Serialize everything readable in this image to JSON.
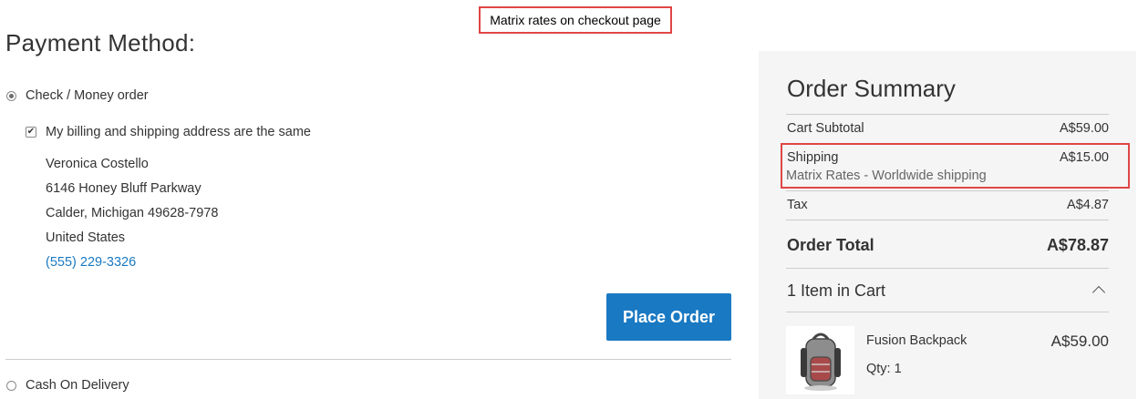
{
  "annotation": {
    "caption": "Matrix rates on checkout page"
  },
  "payment": {
    "title": "Payment Method:",
    "option_check": "Check / Money order",
    "billing_same_label": "My billing and shipping address are the same",
    "address": {
      "name": "Veronica Costello",
      "street": "6146 Honey Bluff Parkway",
      "city_line": "Calder, Michigan 49628-7978",
      "country": "United States",
      "phone": "(555) 229-3326"
    },
    "place_order_label": "Place Order",
    "option_cod": "Cash On Delivery"
  },
  "summary": {
    "title": "Order Summary",
    "cart_subtotal_label": "Cart Subtotal",
    "cart_subtotal_value": "A$59.00",
    "shipping_label": "Shipping",
    "shipping_method": "Matrix Rates - Worldwide shipping",
    "shipping_value": "A$15.00",
    "tax_label": "Tax",
    "tax_value": "A$4.87",
    "order_total_label": "Order Total",
    "order_total_value": "A$78.87",
    "items_label": "1 Item in Cart",
    "item": {
      "name": "Fusion Backpack",
      "qty": "Qty: 1",
      "price": "A$59.00"
    }
  },
  "colors": {
    "accent": "#1979c3",
    "highlight": "#e04646",
    "summary_bg": "#f5f5f5"
  },
  "icons": [
    "radio-selected-icon",
    "checkbox-checked-icon",
    "chevron-up-icon",
    "backpack-image"
  ]
}
